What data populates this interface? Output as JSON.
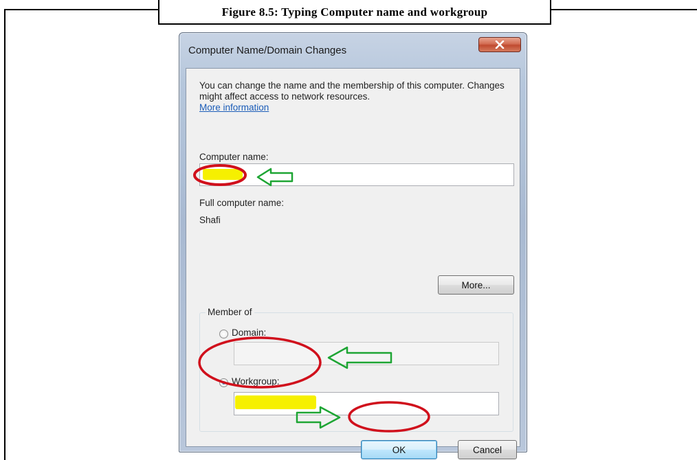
{
  "caption": "Figure 8.5: Typing Computer name and workgroup",
  "dialog": {
    "title": "Computer Name/Domain Changes",
    "description": "You can change the name and the membership of this computer. Changes might affect access to network resources.",
    "more_info_link": "More information",
    "computer_name_label": "Computer name:",
    "computer_name_value": "",
    "full_name_label": "Full computer name:",
    "full_name_value": "Shafi",
    "more_button": "More...",
    "member_of_label": "Member of",
    "domain_label": "Domain:",
    "domain_value": "",
    "workgroup_label": "Workgroup:",
    "workgroup_value": "",
    "workgroup_selected": true,
    "ok_button": "OK",
    "cancel_button": "Cancel"
  },
  "annotations": {
    "ellipse_color": "#d0101c",
    "arrow_color": "#1ea534",
    "highlight_color": "#f6f000"
  },
  "icons": {
    "close": "close-icon"
  }
}
